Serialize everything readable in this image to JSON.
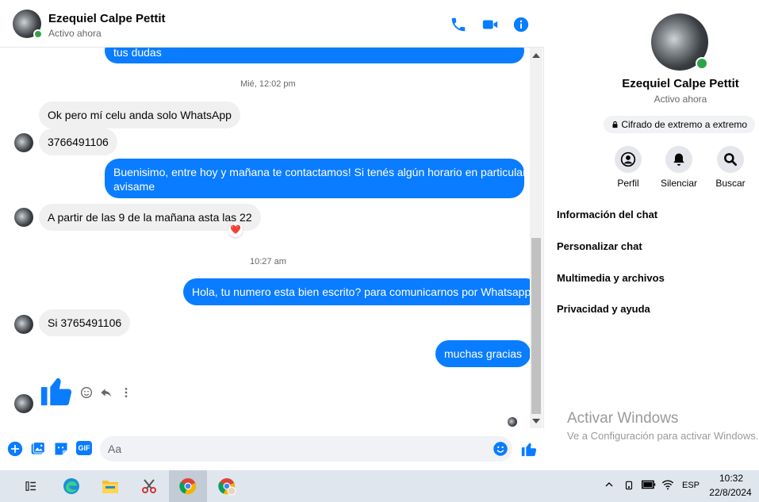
{
  "contact": {
    "name": "Ezequiel Calpe Pettit",
    "status": "Activo ahora"
  },
  "header_icons": [
    "phone-icon",
    "video-icon",
    "info-icon"
  ],
  "messages": {
    "partial_top": "tus dudas",
    "ts1": "Mié, 12:02 pm",
    "m1": "Ok pero mí celu anda solo WhatsApp",
    "m2": "3766491106",
    "m3_line1": "Buenisimo, entre hoy y mañana te contactamos! Si tenés algún horario en particular",
    "m3_line2": "avisame",
    "m4": "A partir de las 9 de la mañana asta las 22",
    "m4_reaction": "❤️",
    "ts2": "10:27 am",
    "m5": "Hola, tu numero esta bien escrito? para comunicarnos por Whatsapp",
    "m6": "Si 3765491106",
    "m7": "muchas gracias"
  },
  "composer": {
    "placeholder": "Aa",
    "gif_label": "GIF"
  },
  "info_panel": {
    "name": "Ezequiel Calpe Pettit",
    "status": "Activo ahora",
    "encryption": "Cifrado de extremo a extremo",
    "actions": [
      {
        "label": "Perfil",
        "icon": "profile-icon"
      },
      {
        "label": "Silenciar",
        "icon": "bell-icon"
      },
      {
        "label": "Buscar",
        "icon": "search-icon"
      }
    ],
    "menu": [
      "Información del chat",
      "Personalizar chat",
      "Multimedia y archivos",
      "Privacidad y ayuda"
    ]
  },
  "watermark": {
    "title": "Activar Windows",
    "subtitle": "Ve a Configuración para activar Windows."
  },
  "taskbar": {
    "language": "ESP",
    "time": "10:32",
    "date": "22/8/2024"
  },
  "colors": {
    "accent": "#0a7cff",
    "online": "#31a24c",
    "incoming_bubble": "#f0f0f0"
  }
}
